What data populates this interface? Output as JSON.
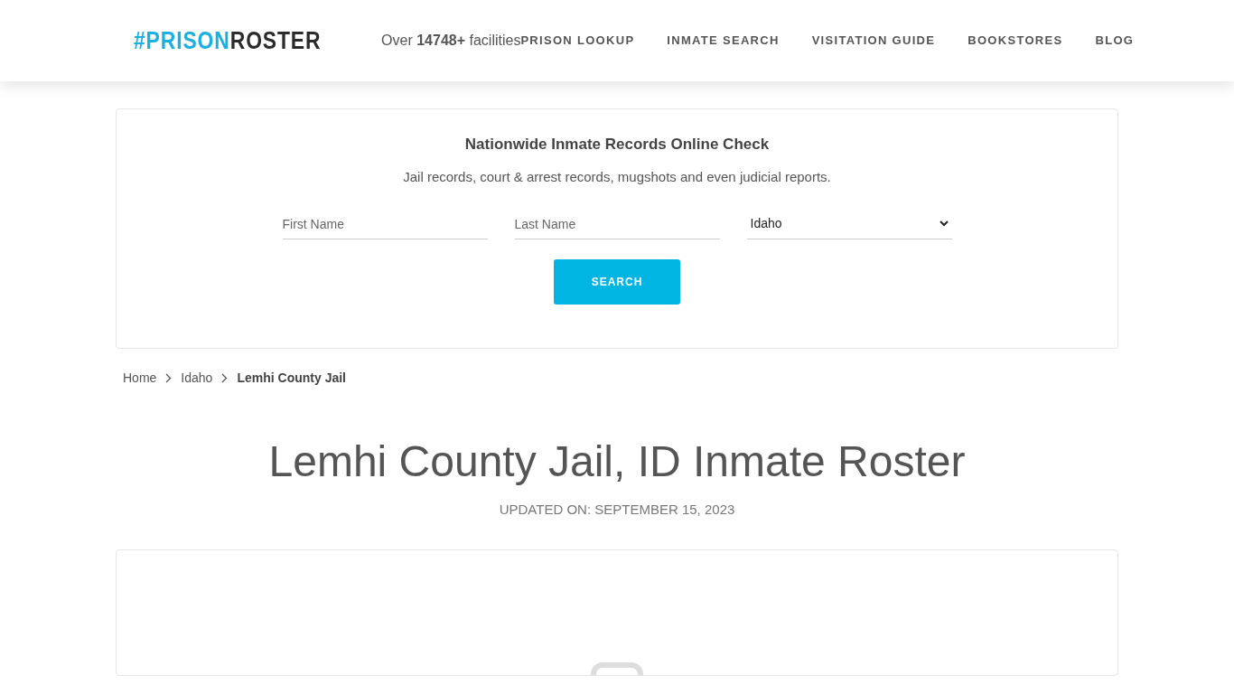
{
  "header": {
    "logo": {
      "first": "#PRISON",
      "second": "ROSTER"
    },
    "facilities": "Over **14748+** facilities",
    "nav": [
      {
        "label": "PRISON LOOKUP"
      },
      {
        "label": "INMATE SEARCH"
      },
      {
        "label": "VISITATION GUIDE"
      },
      {
        "label": "BOOKSTORES"
      },
      {
        "label": "BLOG"
      }
    ]
  },
  "search_card": {
    "title": "Nationwide Inmate Records Online Check",
    "subtitle": "Jail records, court & arrest records, mugshots and even judicial reports.",
    "first_name": {
      "placeholder": "First Name"
    },
    "last_name": {
      "placeholder": "Last Name"
    },
    "state": {
      "value": "Idaho"
    },
    "button": "SEARCH"
  },
  "breadcrumbs": [
    {
      "label": "Home",
      "current": false
    },
    {
      "label": "Idaho",
      "current": false
    },
    {
      "label": "Lemhi County Jail",
      "current": true
    }
  ],
  "heading": "Lemhi County Jail, ID Inmate Roster",
  "updated": "UPDATED ON: SEPTEMBER 15, 2023"
}
